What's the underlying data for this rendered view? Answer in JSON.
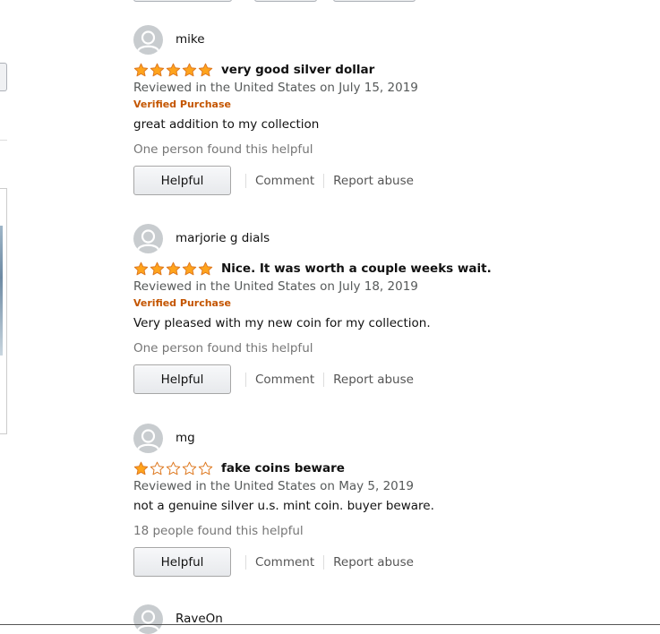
{
  "reviews": [
    {
      "name": "mike",
      "rating": 5,
      "title": "very good silver dollar",
      "date": "Reviewed in the United States on July 15, 2019",
      "verified": "Verified Purchase",
      "body": "great addition to my collection",
      "helpful_count": "One person found this helpful"
    },
    {
      "name": "marjorie g dials",
      "rating": 5,
      "title": "Nice. It was worth a couple weeks wait.",
      "date": "Reviewed in the United States on July 18, 2019",
      "verified": "Verified Purchase",
      "body": "Very pleased with my new coin for my collection.",
      "helpful_count": "One person found this helpful"
    },
    {
      "name": "mg",
      "rating": 1,
      "title": "fake coins beware",
      "date": "Reviewed in the United States on May 5, 2019",
      "verified": "",
      "body": "not a genuine silver u.s. mint coin. buyer beware.",
      "helpful_count": "18 people found this helpful"
    },
    {
      "name": "RaveOn"
    }
  ],
  "actions": {
    "helpful_label": "Helpful",
    "comment_label": "Comment",
    "report_label": "Report abuse"
  },
  "colors": {
    "star_fill": "#ffa41c",
    "star_stroke": "#de7921",
    "verified": "#c45500",
    "muted_text": "#565959"
  }
}
